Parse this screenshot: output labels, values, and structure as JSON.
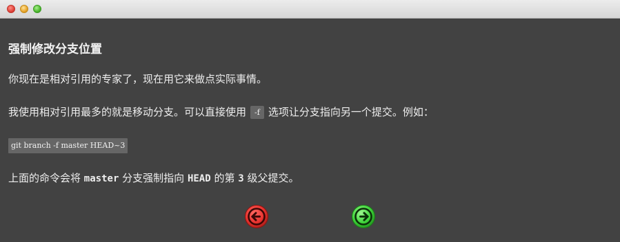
{
  "window": {
    "controls": [
      "close",
      "minimize",
      "zoom"
    ]
  },
  "lesson": {
    "title": "强制修改分支位置",
    "paragraph1": "你现在是相对引用的专家了，现在用它来做点实际事情。",
    "paragraph2": {
      "before": "我使用相对引用最多的就是移动分支。可以直接使用",
      "option": "-f",
      "after": "选项让分支指向另一个提交。例如："
    },
    "code_example": "git branch -f master HEAD~3",
    "paragraph3": {
      "part1": "上面的命令会将",
      "branch": "master",
      "part2": "分支强制指向",
      "ref": "HEAD",
      "part3": "的第",
      "number": "3",
      "part4": "级父提交。"
    }
  },
  "navigation": {
    "back_icon": "arrow-left-icon",
    "forward_icon": "arrow-right-icon",
    "back_color": "#e8322e",
    "forward_color": "#3fd43a"
  }
}
